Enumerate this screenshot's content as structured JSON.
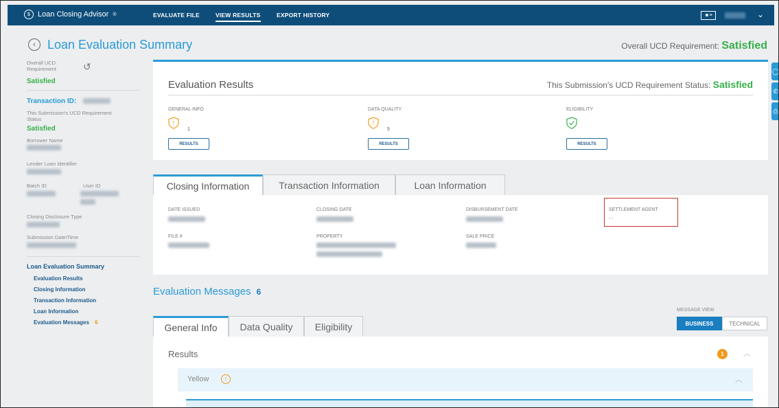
{
  "app": {
    "name": "Loan Closing Advisor"
  },
  "nav": {
    "evaluate": "EVALUATE FILE",
    "view": "VIEW RESULTS",
    "export": "EXPORT HISTORY"
  },
  "header": {
    "title": "Loan Evaluation Summary",
    "overall_label": "Overall UCD Requirement:",
    "overall_value": "Satisfied"
  },
  "sidebar": {
    "overall_label": "Overall UCD Requirement",
    "overall_value": "Satisfied",
    "transaction_label": "Transaction ID:",
    "submission_label": "This Submission's UCD Requirement Status",
    "submission_value": "Satisfied",
    "borrower_label": "Borrower Name",
    "lender_label": "Lender Loan Identifier",
    "batch_label": "Batch ID",
    "user_label": "User ID",
    "cd_type_label": "Closing Disclosure Type",
    "submission_dt_label": "Submission Date/Time",
    "nav_title": "Loan Evaluation Summary",
    "links": [
      "Evaluation Results",
      "Closing Information",
      "Transaction Information",
      "Loan Information"
    ],
    "messages_link": "Evaluation Messages",
    "messages_count": "6"
  },
  "eval_results": {
    "title": "Evaluation Results",
    "status_label": "This Submission's UCD Requirement Status:",
    "status_value": "Satisfied",
    "categories": [
      {
        "label": "GENERAL INFO",
        "count": "1",
        "button": "RESULTS",
        "icon": "warning-shield-icon"
      },
      {
        "label": "DATA QUALITY",
        "count": "5",
        "button": "RESULTS",
        "icon": "warning-shield-icon"
      },
      {
        "label": "ELIGIBILITY",
        "count": "",
        "button": "RESULTS",
        "icon": "check-shield-icon"
      }
    ]
  },
  "info_tabs": [
    "Closing Information",
    "Transaction Information",
    "Loan Information"
  ],
  "closing_info": {
    "date_issued": "DATE ISSUED",
    "closing_date": "CLOSING DATE",
    "disbursement_date": "DISBURSEMENT DATE",
    "settlement_agent": "SETTLEMENT AGENT",
    "settlement_agent_value": "- -",
    "file_no": "FILE #",
    "property": "PROPERTY",
    "sale_price": "SALE PRICE"
  },
  "messages": {
    "title": "Evaluation Messages",
    "count": "6",
    "view_label": "MESSAGE VIEW",
    "view_business": "BUSINESS",
    "view_technical": "TECHNICAL",
    "tabs": [
      "General Info",
      "Data Quality",
      "Eligibility"
    ],
    "results_title": "Results",
    "results_count": "1",
    "yellow_label": "Yellow"
  },
  "colors": {
    "brand": "#0e4d7a",
    "accent": "#2a9ad6",
    "success": "#38b04a",
    "warning": "#f39a1e",
    "highlight": "#c0392b"
  }
}
